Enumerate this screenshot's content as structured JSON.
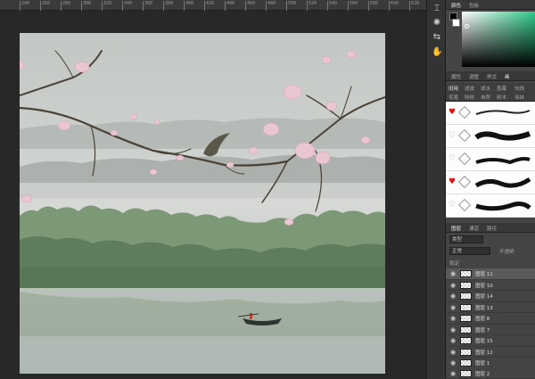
{
  "ruler": {
    "ticks": [
      "240",
      "260",
      "280",
      "300",
      "320",
      "340",
      "360",
      "380",
      "400",
      "420",
      "440",
      "460",
      "480",
      "500",
      "520",
      "540",
      "560",
      "580",
      "600",
      "620"
    ]
  },
  "tools": {
    "icons": [
      "text-cursor-icon",
      "gear-brush-icon",
      "adjust-icon",
      "hand-icon"
    ]
  },
  "color_panel": {
    "tabs": [
      "颜色",
      "色板"
    ],
    "accent": "#2ecc8a"
  },
  "mid_panel": {
    "tabs": [
      "属性",
      "调整",
      "样式",
      "画"
    ]
  },
  "brush_panel": {
    "tabs_row1": [
      "旧用",
      "滤波",
      "滤水",
      "墨幕",
      "句线"
    ],
    "tabs_row2": [
      "毛笔",
      "特效",
      "自然",
      "树木",
      "涂抹"
    ],
    "rows": [
      {
        "favorite": true
      },
      {
        "favorite": false
      },
      {
        "favorite": false
      },
      {
        "favorite": true
      },
      {
        "favorite": false
      }
    ]
  },
  "layers_panel": {
    "tabs": [
      "图层",
      "通道",
      "路径"
    ],
    "filter_label": "类型",
    "blend_mode": "正常",
    "opacity_label": "不透明",
    "lock_label": "锁定",
    "layers": [
      {
        "name": "图层 11",
        "selected": true
      },
      {
        "name": "图层 10",
        "selected": false
      },
      {
        "name": "图层 14",
        "selected": false
      },
      {
        "name": "图层 13",
        "selected": false
      },
      {
        "name": "图层 8",
        "selected": false
      },
      {
        "name": "图层 7",
        "selected": false
      },
      {
        "name": "图层 15",
        "selected": false
      },
      {
        "name": "图层 12",
        "selected": false
      },
      {
        "name": "图层 1",
        "selected": false
      },
      {
        "name": "图层 2",
        "selected": false
      }
    ]
  }
}
